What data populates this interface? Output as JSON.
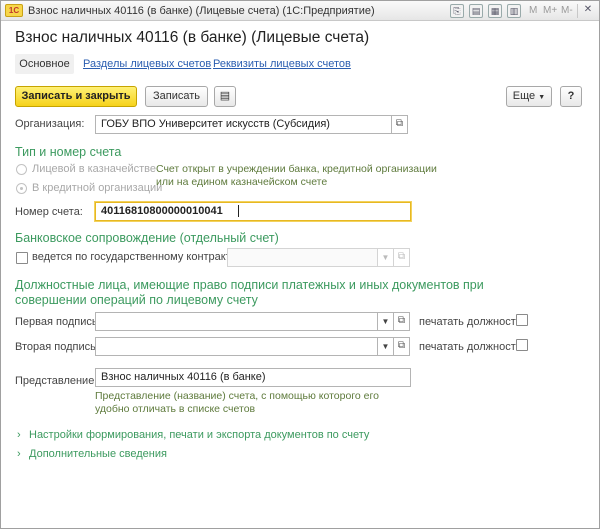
{
  "window": {
    "title": "Взнос наличных 40116 (в банке) (Лицевые счета)  (1С:Предприятие)",
    "logo_text": "1С",
    "toolbar": {
      "m_label": "M",
      "mplus_label": "M+",
      "mminus_label": "M-"
    }
  },
  "form": {
    "title": "Взнос наличных 40116 (в банке) (Лицевые счета)",
    "tabs": [
      {
        "label": "Основное",
        "active": true
      },
      {
        "label": "Разделы лицевых счетов",
        "active": false
      },
      {
        "label": "Реквизиты лицевых счетов",
        "active": false
      }
    ],
    "buttons": {
      "save_close": "Записать и закрыть",
      "save": "Записать",
      "more": "Еще",
      "help": "?"
    },
    "organization": {
      "label": "Организация:",
      "value": "ГОБУ ВПО Университет искусств (Субсидия)"
    },
    "account_type": {
      "section": "Тип и номер счета",
      "option_treasury": "Лицевой в казначействе",
      "option_credit": "В кредитной организации",
      "hint": "Счет открыт в учреждении банка, кредитной организации или на едином казначейском счете"
    },
    "account_number": {
      "label": "Номер счета:",
      "value": "40116810800000010041"
    },
    "bank_support": {
      "section": "Банковское сопровождение (отдельный счет)",
      "checkbox_label": "ведется по государственному контракту:"
    },
    "signatures": {
      "section": "Должностные лица, имеющие право подписи платежных и иных документов при совершении операций по лицевому счету",
      "first_label": "Первая подпись:",
      "second_label": "Вторая подпись:",
      "print_position_label": "печатать должность:"
    },
    "representation": {
      "label": "Представление:",
      "value": "Взнос наличных 40116 (в банке)",
      "hint": "Представление (название) счета, с помощью которого его удобно отличать в списке счетов"
    },
    "expanders": {
      "settings": "Настройки формирования, печати и экспорта документов по счету",
      "additional": "Дополнительные сведения"
    }
  },
  "colors": {
    "accent_green": "#3c9a5f",
    "link_blue": "#2a5db0",
    "primary_yellow": "#f6d21b"
  }
}
